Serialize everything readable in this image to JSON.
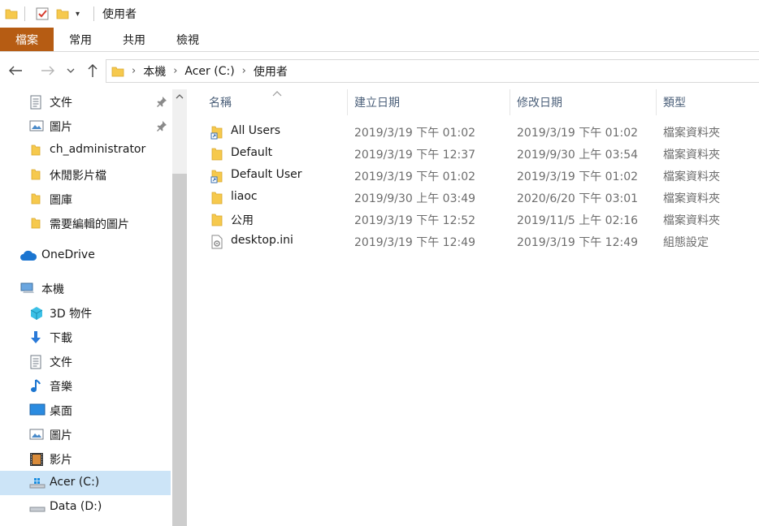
{
  "window": {
    "title": "使用者"
  },
  "ribbon": {
    "tabs": [
      "檔案",
      "常用",
      "共用",
      "檢視"
    ]
  },
  "address": {
    "crumbs": [
      "本機",
      "Acer (C:)",
      "使用者"
    ]
  },
  "nav": {
    "quick_access": [
      {
        "label": "文件",
        "icon": "document-icon",
        "pinned": true
      },
      {
        "label": "圖片",
        "icon": "pictures-icon",
        "pinned": true
      },
      {
        "label": "ch_administrator",
        "icon": "folder-icon",
        "pinned": false
      },
      {
        "label": "休閒影片檔",
        "icon": "folder-icon",
        "pinned": false
      },
      {
        "label": "圖庫",
        "icon": "folder-icon",
        "pinned": false
      },
      {
        "label": "需要編輯的圖片",
        "icon": "folder-icon",
        "pinned": false
      }
    ],
    "onedrive": {
      "label": "OneDrive",
      "icon": "cloud-icon"
    },
    "this_pc": {
      "label": "本機",
      "icon": "computer-icon"
    },
    "pc_items": [
      {
        "label": "3D 物件",
        "icon": "3d-objects-icon"
      },
      {
        "label": "下載",
        "icon": "download-icon"
      },
      {
        "label": "文件",
        "icon": "document-icon"
      },
      {
        "label": "音樂",
        "icon": "music-icon"
      },
      {
        "label": "桌面",
        "icon": "desktop-icon"
      },
      {
        "label": "圖片",
        "icon": "pictures-icon"
      },
      {
        "label": "影片",
        "icon": "video-icon"
      },
      {
        "label": "Acer (C:)",
        "icon": "windows-drive-icon",
        "selected": true
      },
      {
        "label": "Data (D:)",
        "icon": "drive-icon"
      }
    ]
  },
  "columns": {
    "name": "名稱",
    "created": "建立日期",
    "modified": "修改日期",
    "type": "類型"
  },
  "files": [
    {
      "name": "All Users",
      "icon": "folder-shortcut-icon",
      "created": "2019/3/19 下午 01:02",
      "modified": "2019/3/19 下午 01:02",
      "type": "檔案資料夾"
    },
    {
      "name": "Default",
      "icon": "folder-icon",
      "created": "2019/3/19 下午 12:37",
      "modified": "2019/9/30 上午 03:54",
      "type": "檔案資料夾"
    },
    {
      "name": "Default User",
      "icon": "folder-shortcut-icon",
      "created": "2019/3/19 下午 01:02",
      "modified": "2019/3/19 下午 01:02",
      "type": "檔案資料夾"
    },
    {
      "name": "liaoc",
      "icon": "folder-icon",
      "created": "2019/9/30 上午 03:49",
      "modified": "2020/6/20 下午 03:01",
      "type": "檔案資料夾"
    },
    {
      "name": "公用",
      "icon": "folder-icon",
      "created": "2019/3/19 下午 12:52",
      "modified": "2019/11/5 上午 02:16",
      "type": "檔案資料夾"
    },
    {
      "name": "desktop.ini",
      "icon": "settings-file-icon",
      "created": "2019/3/19 下午 12:49",
      "modified": "2019/3/19 下午 12:49",
      "type": "組態設定"
    }
  ],
  "colors": {
    "file_tab": "#b65c13",
    "selected": "#cce4f7",
    "folder": "#f6c94d",
    "header_text": "#4c607a"
  }
}
